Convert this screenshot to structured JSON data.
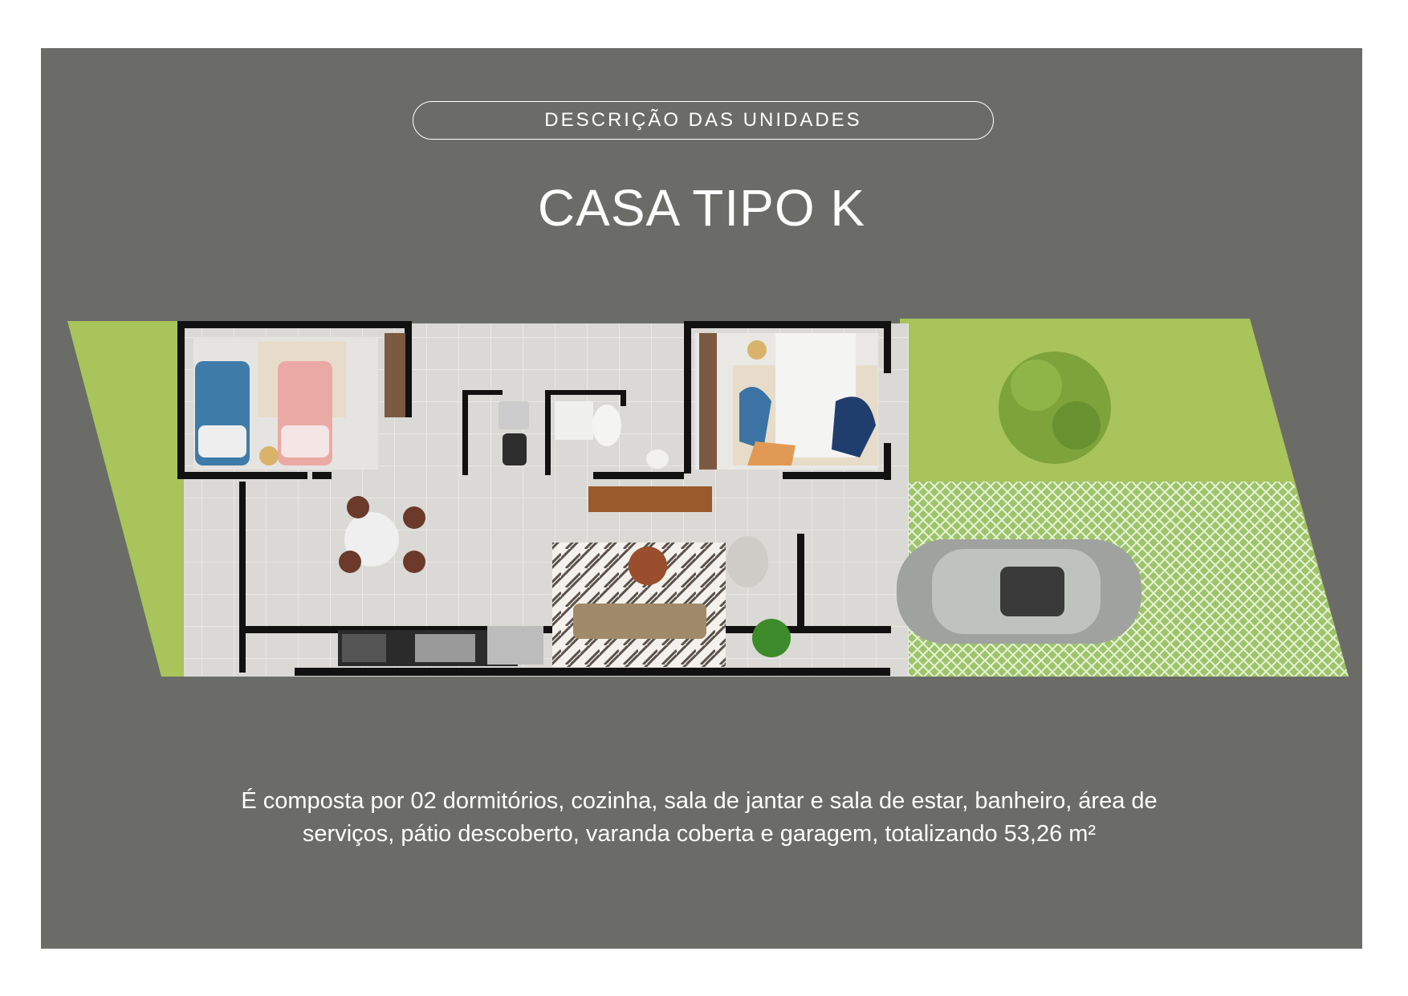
{
  "header": {
    "section_label": "DESCRIÇÃO DAS UNIDADES",
    "title": "CASA TIPO K"
  },
  "description": {
    "text": "É composta por 02 dormitórios, cozinha, sala de jantar e sala de estar, banheiro, área de serviços, pátio descoberto, varanda coberta e garagem, totalizando 53,26 m²"
  },
  "colors": {
    "panel_background": "#6b6c68",
    "lawn": "#a8c45a",
    "floor": "#d9d8d5",
    "wall": "#111111",
    "text": "#ffffff"
  }
}
